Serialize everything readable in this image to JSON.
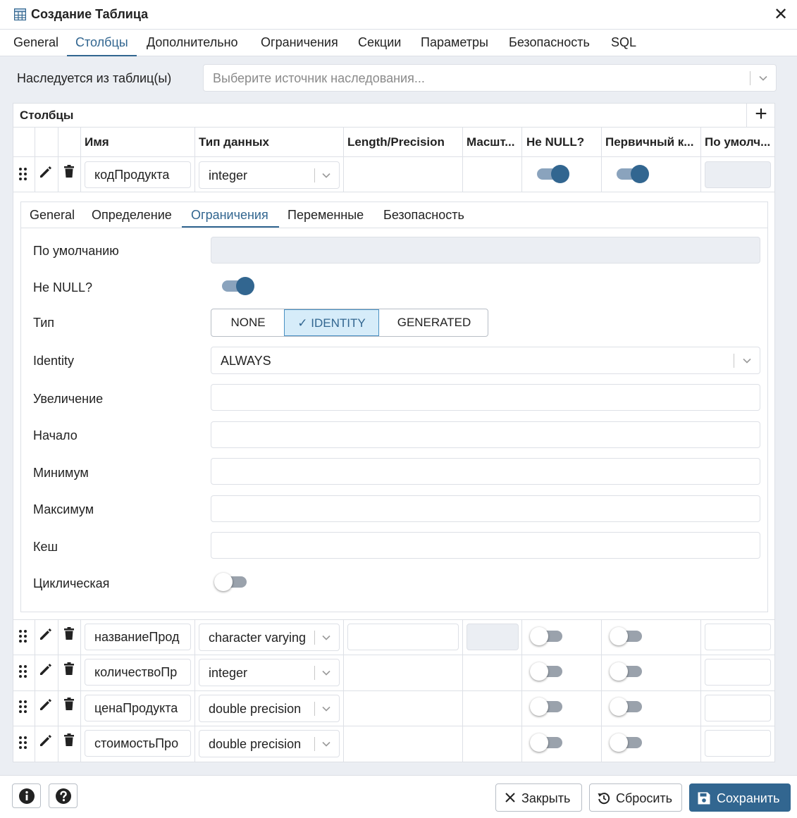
{
  "dialog": {
    "title": "Создание Таблица",
    "close_glyph": "✕"
  },
  "main_tabs": [
    "General",
    "Столбцы",
    "Дополнительно",
    "Ограничения",
    "Секции",
    "Параметры",
    "Безопасность",
    "SQL"
  ],
  "main_tab_active": "Столбцы",
  "inherit": {
    "label": "Наследуется из таблиц(ы)",
    "placeholder": "Выберите источник наследования..."
  },
  "columns": {
    "title": "Столбцы",
    "add_glyph": "+",
    "headers": [
      "Имя",
      "Тип данных",
      "Length/Precision",
      "Масшт...",
      "Не NULL?",
      "Первичный к...",
      "По умолч..."
    ],
    "rows": [
      {
        "name": "кодПродукта",
        "type": "integer",
        "not_null": true,
        "primary_key": true
      },
      {
        "name": "названиеПрод",
        "type": "character varying",
        "not_null": false,
        "primary_key": false
      },
      {
        "name": "количествоПр",
        "type": "integer",
        "not_null": false,
        "primary_key": false
      },
      {
        "name": "ценаПродукта",
        "type": "double precision",
        "not_null": false,
        "primary_key": false
      },
      {
        "name": "стоимостьПро",
        "type": "double precision",
        "not_null": false,
        "primary_key": false
      }
    ]
  },
  "sub_tabs": [
    "General",
    "Определение",
    "Ограничения",
    "Переменные",
    "Безопасность"
  ],
  "sub_tab_active": "Ограничения",
  "constraints": {
    "default_label": "По умолчанию",
    "not_null_label": "Не NULL?",
    "not_null": true,
    "type_label": "Тип",
    "type_options": [
      "NONE",
      "IDENTITY",
      "GENERATED"
    ],
    "type_selected": "IDENTITY",
    "check_glyph": "✓",
    "identity_label": "Identity",
    "identity_value": "ALWAYS",
    "increment_label": "Увеличение",
    "start_label": "Начало",
    "minimum_label": "Минимум",
    "maximum_label": "Максимум",
    "cache_label": "Кеш",
    "cyclic_label": "Циклическая",
    "cyclic": false
  },
  "footer": {
    "close_label": "Закрыть",
    "reset_label": "Сбросить",
    "save_label": "Сохранить"
  },
  "colors": {
    "accent": "#326690",
    "panel_bg": "#ebeef3",
    "border": "#dde0e6",
    "selected_bg": "#d6ecf9"
  },
  "icons": [
    "table-icon",
    "close-icon",
    "add-icon",
    "drag-handle-icon",
    "edit-icon",
    "trash-icon",
    "chevron-down-icon",
    "info-icon",
    "help-icon",
    "reset-icon",
    "save-icon"
  ]
}
